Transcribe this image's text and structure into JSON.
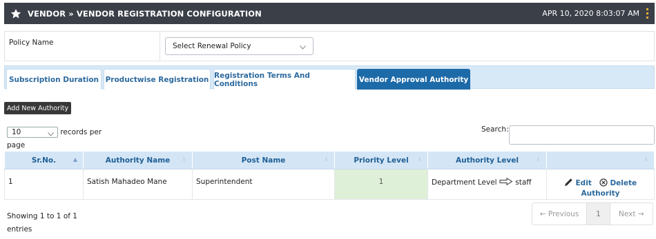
{
  "header": {
    "title": "VENDOR » VENDOR REGISTRATION CONFIGURATION",
    "datetime": "APR 10, 2020  8:03:07 AM"
  },
  "policy": {
    "label": "Policy Name",
    "selected": "Select Renewal Policy"
  },
  "tabs": [
    {
      "label": "Subscription Duration"
    },
    {
      "label": "Productwise Registration"
    },
    {
      "label": "Registration Terms And Conditions"
    },
    {
      "label": "Vendor Approval Authority"
    }
  ],
  "add_button": "Add New Authority",
  "length": {
    "value": "10",
    "suffix": "records per",
    "suffix2": "page"
  },
  "search": {
    "label": "Search:"
  },
  "table": {
    "headers": [
      "Sr.No.",
      "Authority Name",
      "Post Name",
      "Priority Level",
      "Authority Level",
      ""
    ],
    "rows": [
      {
        "sr": "1",
        "authority_name": "Satish Mahadeo Mane",
        "post_name": "Superintendent",
        "priority": "1",
        "level_from": "Department Level",
        "level_to": "staff",
        "edit": "Edit",
        "delete": "Delete",
        "delete2": "Authority"
      }
    ]
  },
  "info": {
    "line1": "Showing 1 to 1 of 1",
    "line2": "entries"
  },
  "pager": {
    "prev": "← Previous",
    "page": "1",
    "next": "Next →"
  }
}
